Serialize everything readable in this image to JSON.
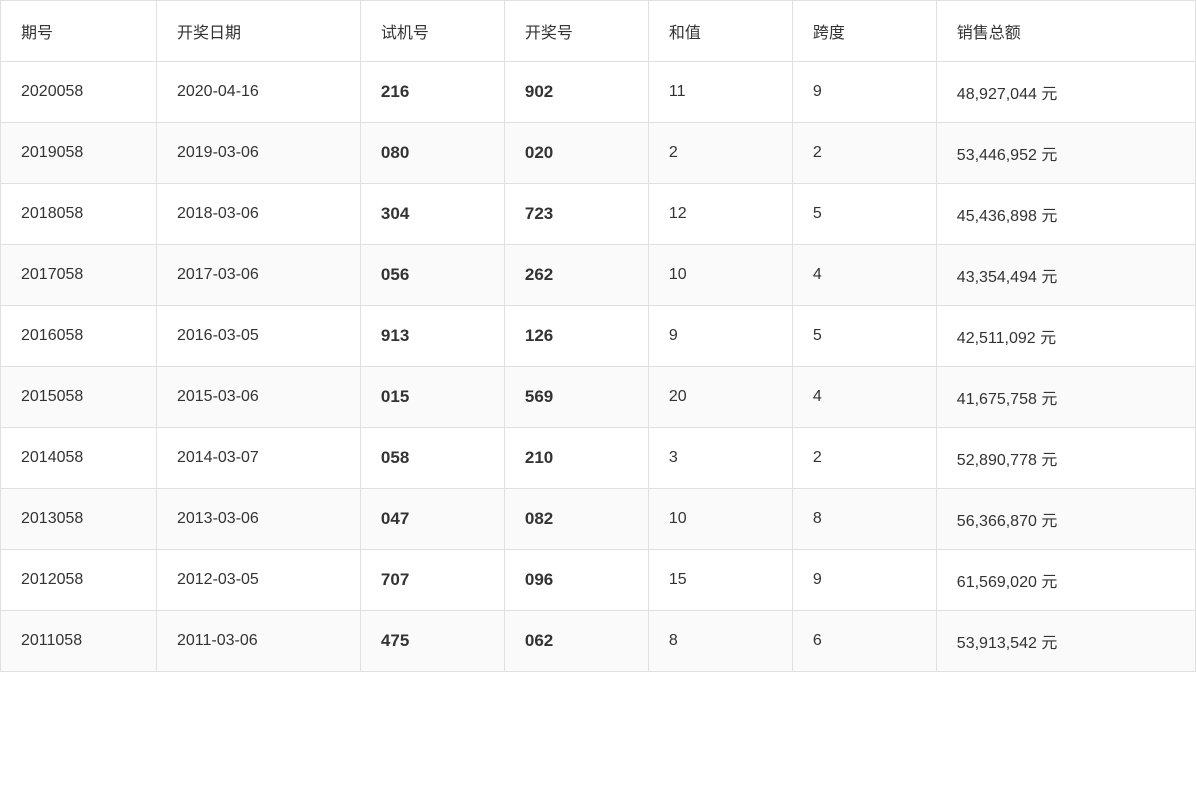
{
  "table": {
    "headers": [
      "期号",
      "开奖日期",
      "试机号",
      "开奖号",
      "和值",
      "跨度",
      "销售总额"
    ],
    "rows": [
      {
        "period": "2020058",
        "date": "2020-04-16",
        "trial": "216",
        "draw": "902",
        "sum": "11",
        "span": "9",
        "sales": "48,927,044 元"
      },
      {
        "period": "2019058",
        "date": "2019-03-06",
        "trial": "080",
        "draw": "020",
        "sum": "2",
        "span": "2",
        "sales": "53,446,952 元"
      },
      {
        "period": "2018058",
        "date": "2018-03-06",
        "trial": "304",
        "draw": "723",
        "sum": "12",
        "span": "5",
        "sales": "45,436,898 元"
      },
      {
        "period": "2017058",
        "date": "2017-03-06",
        "trial": "056",
        "draw": "262",
        "sum": "10",
        "span": "4",
        "sales": "43,354,494 元"
      },
      {
        "period": "2016058",
        "date": "2016-03-05",
        "trial": "913",
        "draw": "126",
        "sum": "9",
        "span": "5",
        "sales": "42,511,092 元"
      },
      {
        "period": "2015058",
        "date": "2015-03-06",
        "trial": "015",
        "draw": "569",
        "sum": "20",
        "span": "4",
        "sales": "41,675,758 元"
      },
      {
        "period": "2014058",
        "date": "2014-03-07",
        "trial": "058",
        "draw": "210",
        "sum": "3",
        "span": "2",
        "sales": "52,890,778 元"
      },
      {
        "period": "2013058",
        "date": "2013-03-06",
        "trial": "047",
        "draw": "082",
        "sum": "10",
        "span": "8",
        "sales": "56,366,870 元"
      },
      {
        "period": "2012058",
        "date": "2012-03-05",
        "trial": "707",
        "draw": "096",
        "sum": "15",
        "span": "9",
        "sales": "61,569,020 元"
      },
      {
        "period": "2011058",
        "date": "2011-03-06",
        "trial": "475",
        "draw": "062",
        "sum": "8",
        "span": "6",
        "sales": "53,913,542 元"
      }
    ]
  }
}
